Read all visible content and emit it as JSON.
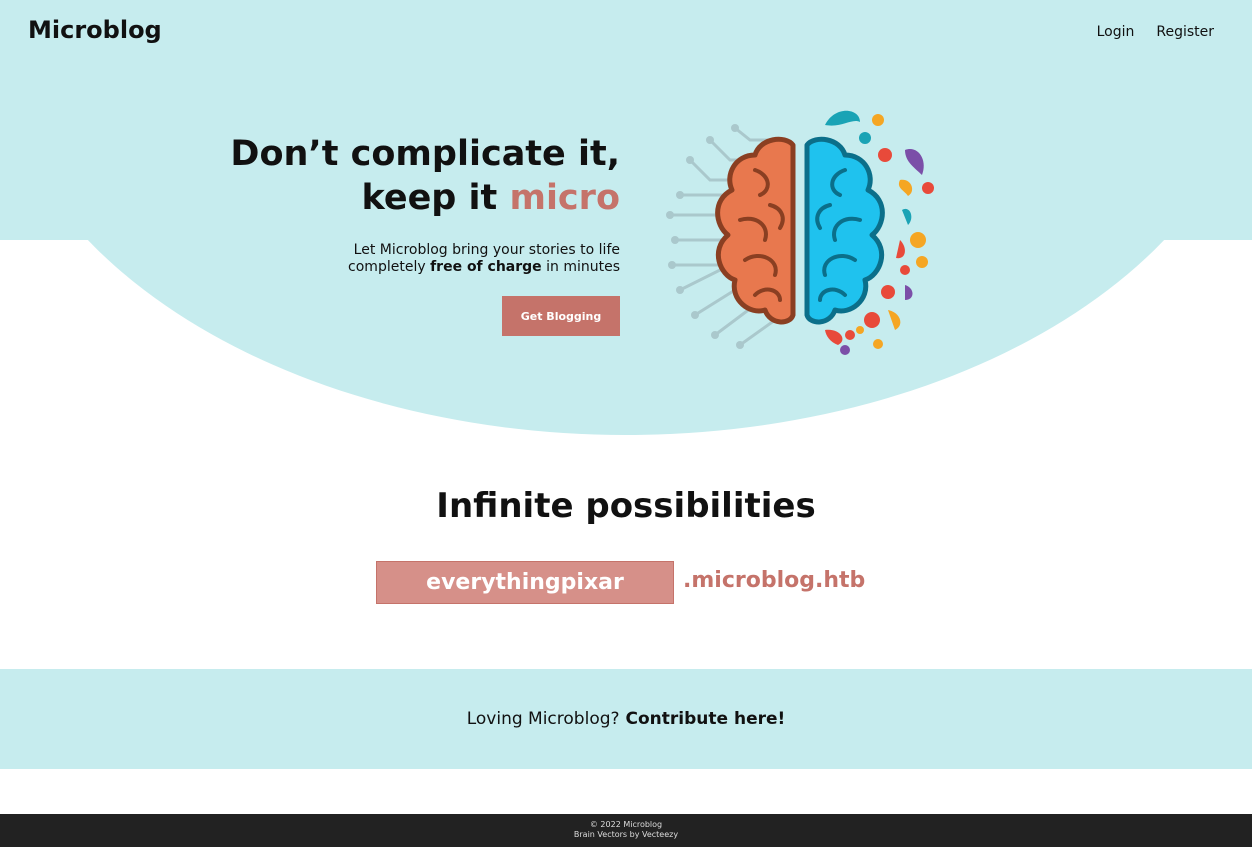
{
  "header": {
    "brand": "Microblog",
    "nav": {
      "login": "Login",
      "register": "Register"
    }
  },
  "hero": {
    "headline_line1": "Don’t complicate it,",
    "headline_line2_prefix": "keep it ",
    "headline_line2_accent": "micro",
    "tagline_line1": "Let Microblog bring your stories to life",
    "tagline_prefix": "completely ",
    "tagline_bold": "free of charge",
    "tagline_suffix": " in minutes",
    "cta_label": "Get Blogging",
    "illustration_icon": "brain-icon"
  },
  "possibilities": {
    "title": "Infinite possibilities",
    "subdomain_value": "everythingpixar",
    "domain_suffix": ".microblog.htb"
  },
  "contribute": {
    "prefix": "Loving Microblog?",
    "link": "Contribute here!"
  },
  "footer": {
    "copyright": "© 2022 Microblog",
    "credit": "Brain Vectors by Vecteezy"
  },
  "colors": {
    "hero_bg": "#c6ecee",
    "accent": "#c5736a",
    "footer_bg": "#222222"
  }
}
